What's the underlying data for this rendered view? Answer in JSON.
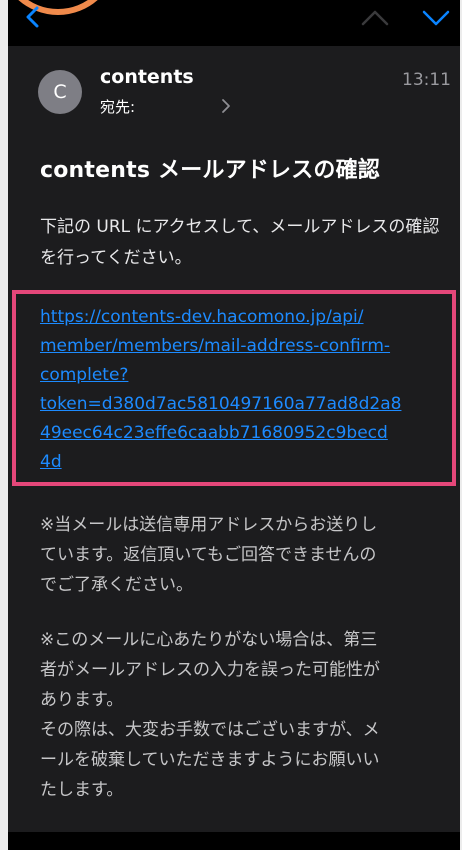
{
  "header": {
    "avatar_initial": "C",
    "sender": "contents",
    "recipient_label": "宛先:",
    "time": "13:11"
  },
  "subject": "contents メールアドレスの確認",
  "body": {
    "intro": "下記の URL にアクセスして、メールアドレスの確認を行ってください。",
    "link": "https://contents-dev.hacomono.jp/api/\nmember/members/mail-address-confirm-\ncomplete?\ntoken=d380d7ac5810497160a77ad8d2a8\n49eec64c23effe6caabb71680952c9becd\n4d",
    "note1": "※当メールは送信専用アドレスからお送りし\nています。返信頂いてもご回答できませんの\nでご了承ください。",
    "note2": "※このメールに心あたりがない場合は、第三\n者がメールアドレスの入力を誤った可能性が\nあります。\nその際は、大変お手数ではございますが、メ\nールを破棄していただきますようにお願いい\nたします。"
  },
  "colors": {
    "accent": "#0a84ff",
    "link": "#1d8bff",
    "highlight_border": "#e5477a",
    "annotation_circle": "#f08a4b",
    "background": "#1c1c1e"
  },
  "icons": {
    "back": "chevron-left-icon",
    "prev": "chevron-up-icon",
    "next": "chevron-down-icon",
    "recipient_expand": "chevron-right-icon"
  }
}
